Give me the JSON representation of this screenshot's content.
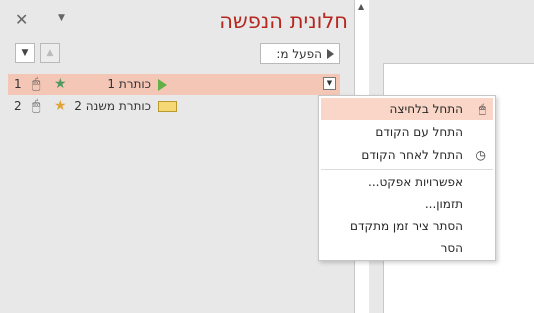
{
  "pane": {
    "title": "חלונית הנפשה",
    "play_label": "הפעל מ:",
    "close_glyph": "✕",
    "menu_glyph": "▼",
    "move_up_glyph": "▲",
    "move_down_glyph": "▼"
  },
  "animations": [
    {
      "num": "1",
      "label": "כותרת 1",
      "star_color": "#4f9a63",
      "selected": true
    },
    {
      "num": "2",
      "label": "כותרת משנה 2",
      "star_color": "#e0a43a",
      "selected": false
    }
  ],
  "context_menu": {
    "items": [
      {
        "label": "התחל בלחיצה",
        "icon": "mouse-icon"
      },
      {
        "label": "התחל עם הקודם",
        "icon": ""
      },
      {
        "label": "התחל לאחר הקודם",
        "icon": "clock-icon"
      },
      {
        "label": "אפשרויות אפקט...",
        "icon": ""
      },
      {
        "label": "תזמון...",
        "icon": ""
      },
      {
        "label": "הסתר ציר זמן מתקדם",
        "icon": ""
      },
      {
        "label": "הסר",
        "icon": ""
      }
    ]
  },
  "colors": {
    "title": "#b5271f",
    "selection": "#f4c6b5",
    "menu_hover": "#f9d6c7"
  }
}
